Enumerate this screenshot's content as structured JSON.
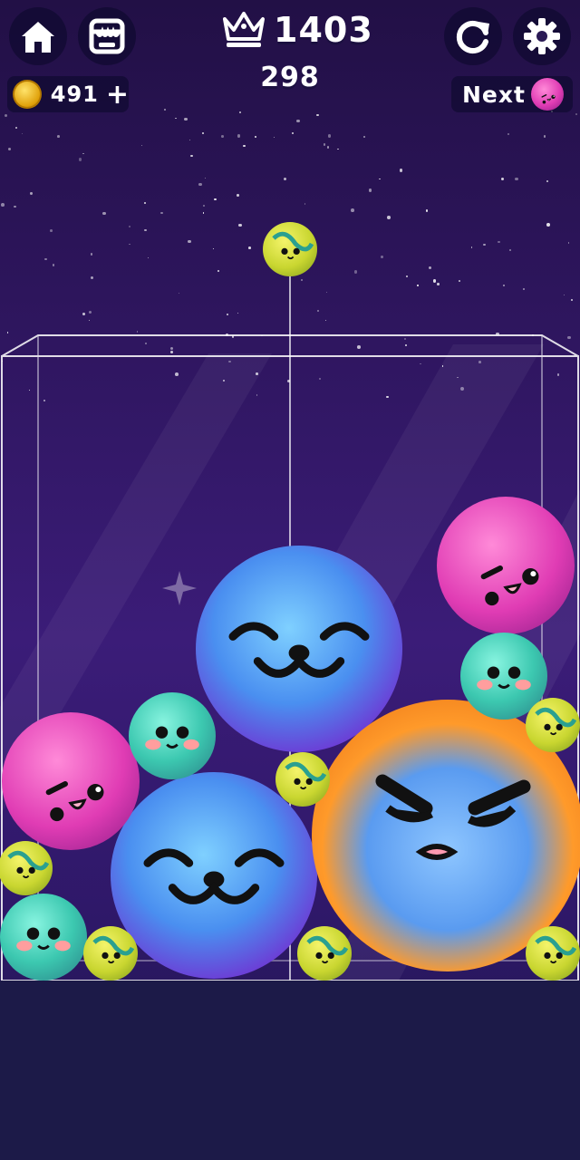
{
  "hud": {
    "home_icon": "home-icon",
    "shop_icon": "shop-icon",
    "coins": "491",
    "coin_plus": "+",
    "best_score": "1403",
    "current_score": "298",
    "restart_icon": "restart-icon",
    "settings_icon": "gear-icon",
    "next_label": "Next",
    "next_ball_type": "pink"
  },
  "colors": {
    "bg_top": "#221046",
    "bg_mid": "#3b1c78",
    "floor": "#1c1a48",
    "hud_pill": "#0a0828",
    "container_line": "#ffffff"
  },
  "game": {
    "held_ball": "yellow",
    "balls": [
      {
        "type": "blue",
        "face": "cat"
      },
      {
        "type": "blue",
        "face": "cat"
      },
      {
        "type": "orange",
        "face": "angry"
      },
      {
        "type": "pink",
        "face": "wink"
      },
      {
        "type": "pink",
        "face": "wink"
      },
      {
        "type": "teal",
        "face": "blush"
      },
      {
        "type": "teal",
        "face": "blush"
      },
      {
        "type": "teal",
        "face": "blush"
      },
      {
        "type": "yellow",
        "face": "small"
      },
      {
        "type": "yellow",
        "face": "small"
      },
      {
        "type": "yellow",
        "face": "small"
      },
      {
        "type": "yellow",
        "face": "small"
      },
      {
        "type": "yellow",
        "face": "small"
      },
      {
        "type": "yellow",
        "face": "small"
      }
    ]
  }
}
